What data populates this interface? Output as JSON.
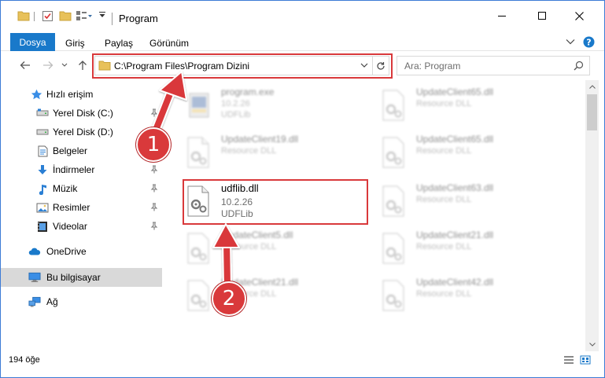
{
  "window": {
    "title": "Program",
    "accent": "#1979ca",
    "callout_color": "#d9393b"
  },
  "ribbon": {
    "tabs": {
      "file": "Dosya",
      "home": "Giriş",
      "share": "Paylaş",
      "view": "Görünüm"
    }
  },
  "address": {
    "path": "C:\\Program Files\\Program Dizini",
    "search_placeholder": "Ara: Program"
  },
  "nav": {
    "quick_access": "Hızlı erişim",
    "items": [
      {
        "label": "Yerel Disk (C:)",
        "icon": "drive-icon",
        "pinned": true
      },
      {
        "label": "Yerel Disk (D:)",
        "icon": "drive-icon",
        "pinned": false
      },
      {
        "label": "Belgeler",
        "icon": "documents-icon",
        "pinned": true
      },
      {
        "label": "İndirmeler",
        "icon": "download-icon",
        "pinned": true
      },
      {
        "label": "Müzik",
        "icon": "music-icon",
        "pinned": true
      },
      {
        "label": "Resimler",
        "icon": "pictures-icon",
        "pinned": true
      },
      {
        "label": "Videolar",
        "icon": "videos-icon",
        "pinned": true
      }
    ],
    "onedrive": "OneDrive",
    "this_pc": "Bu bilgisayar",
    "network": "Ağ"
  },
  "files": {
    "left": [
      {
        "name": "program.exe",
        "line1": "10.2.26",
        "line2": "UDFLib"
      },
      {
        "name": "UpdateClient19.dll",
        "line1": "Resource DLL",
        "line2": ""
      },
      {
        "name": "udflib.dll",
        "line1": "10.2.26",
        "line2": "UDFLib"
      },
      {
        "name": "UpdateClient5.dll",
        "line1": "Resource DLL",
        "line2": ""
      },
      {
        "name": "UpdateClient21.dll",
        "line1": "Resource DLL",
        "line2": ""
      }
    ],
    "right": [
      {
        "name": "UpdateClient65.dll",
        "line1": "Resource DLL"
      },
      {
        "name": "UpdateClient65.dll",
        "line1": "Resource DLL"
      },
      {
        "name": "UpdateClient63.dll",
        "line1": "Resource DLL"
      },
      {
        "name": "UpdateClient21.dll",
        "line1": "Resource DLL"
      },
      {
        "name": "UpdateClient42.dll",
        "line1": "Resource DLL"
      }
    ]
  },
  "status": {
    "item_count": "194 öğe"
  },
  "callouts": {
    "first": "1",
    "second": "2"
  }
}
